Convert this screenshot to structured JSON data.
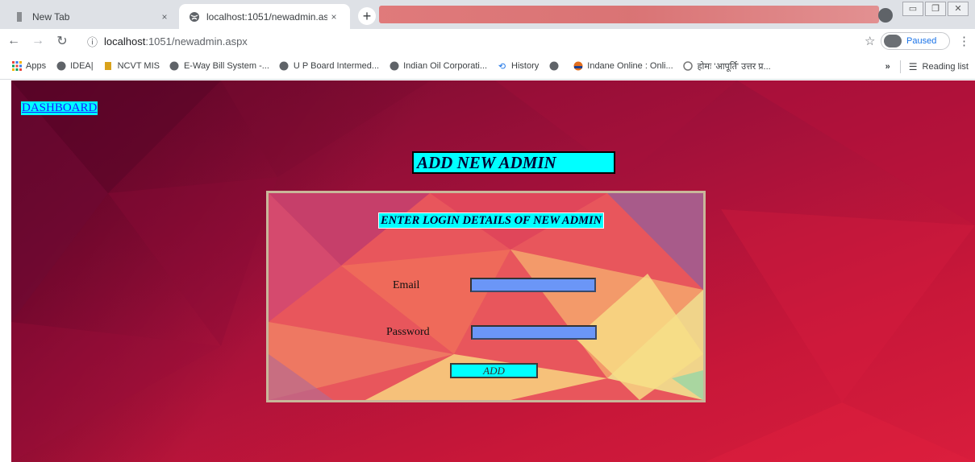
{
  "browser": {
    "tabs": [
      {
        "label": "New Tab",
        "active": false
      },
      {
        "label": "localhost:1051/newadmin.aspx",
        "active": true
      }
    ],
    "new_tab_symbol": "+",
    "close_symbol": "×",
    "address": {
      "host": "localhost",
      "rest": ":1051/newadmin.aspx"
    },
    "profile_status": "Paused",
    "bookmarks": [
      {
        "label": "Apps",
        "icon": "apps-grid-icon"
      },
      {
        "label": "IDEA|",
        "icon": "globe-icon"
      },
      {
        "label": "NCVT MIS",
        "icon": "emblem-icon"
      },
      {
        "label": "E-Way Bill System -...",
        "icon": "globe-icon"
      },
      {
        "label": "U P Board Intermed...",
        "icon": "globe-icon"
      },
      {
        "label": "Indian Oil Corporati...",
        "icon": "globe-icon"
      },
      {
        "label": "History",
        "icon": "history-icon"
      },
      {
        "label": "",
        "icon": "globe-icon"
      },
      {
        "label": "Indane Online : Onli...",
        "icon": "indane-icon"
      },
      {
        "label": "होमः 'आपूर्ति' उत्तर प्र...",
        "icon": "emblem-icon"
      }
    ],
    "more_bookmarks": "»",
    "reading_list": "Reading list"
  },
  "page": {
    "dashboard_link": "DASHBOARD",
    "title": "ADD NEW ADMIN",
    "form": {
      "subtitle": "ENTER LOGIN DETAILS OF NEW ADMIN",
      "email_label": "Email",
      "email_value": "",
      "password_label": "Password",
      "password_value": "",
      "submit_label": "ADD"
    }
  },
  "colors": {
    "accent_cyan": "#00ffff",
    "input_blue": "#6b96f7",
    "background_crimson": "#c81739"
  }
}
